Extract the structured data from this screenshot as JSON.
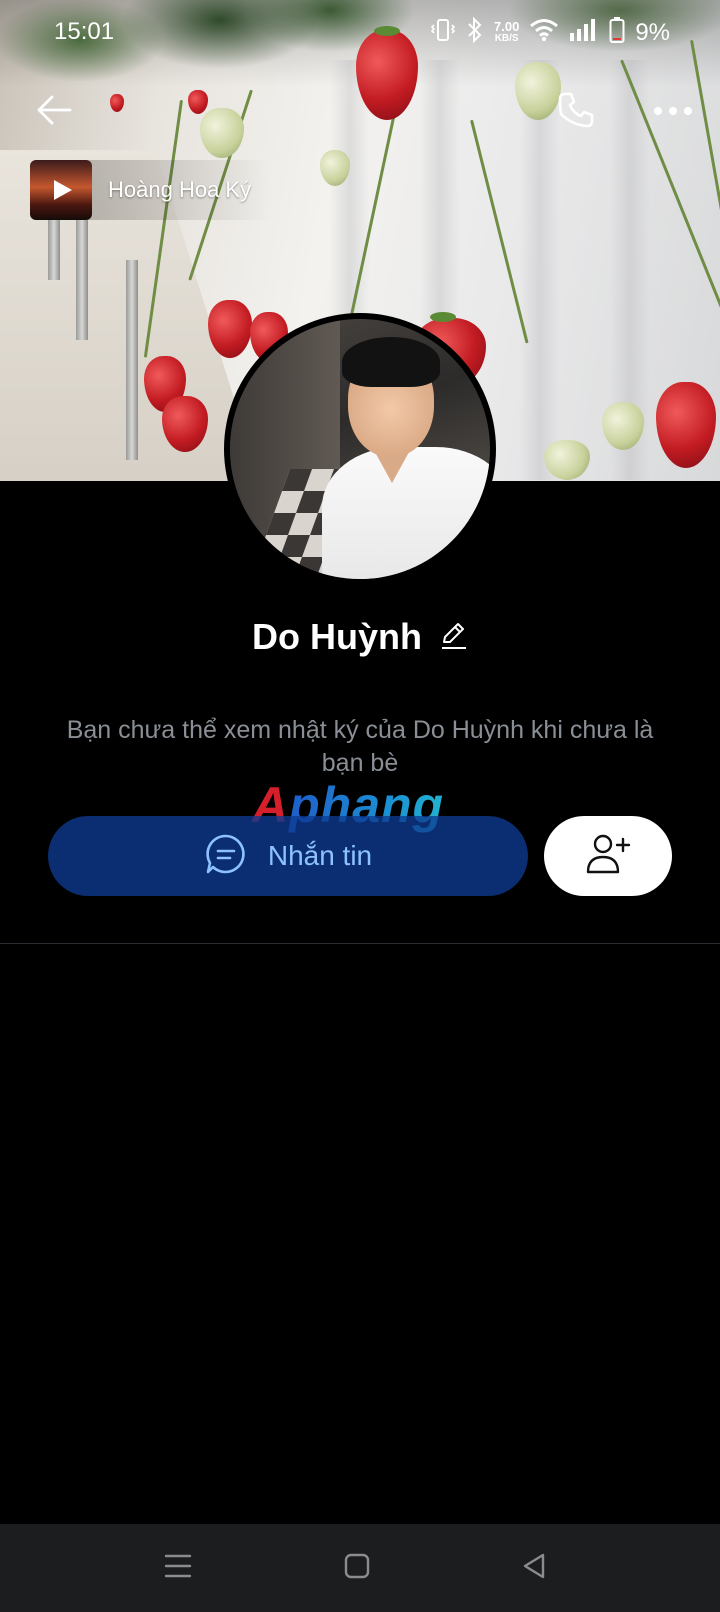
{
  "status_bar": {
    "time": "15:01",
    "network_speed_value": "7.00",
    "network_speed_unit": "KB/S",
    "battery": "9%",
    "icons": [
      "vibrate-icon",
      "bluetooth-icon",
      "wifi-icon",
      "signal-icon",
      "battery-icon"
    ]
  },
  "header": {
    "back_icon": "arrow-left-icon",
    "call_icon": "phone-icon",
    "more_icon": "more-horizontal-icon"
  },
  "music": {
    "title": "Hoàng Hoa Ký",
    "icon": "play-icon"
  },
  "profile": {
    "name": "Do Huỳnh",
    "edit_icon": "pencil-icon",
    "notice": "Bạn chưa thể xem nhật ký của Do Huỳnh khi chưa là bạn bè"
  },
  "watermark": "Aphang",
  "actions": {
    "message_label": "Nhắn tin",
    "message_icon": "chat-bubble-icon",
    "add_friend_icon": "add-user-icon"
  },
  "nav_bar": {
    "icons": [
      "menu-icon",
      "home-square-icon",
      "back-triangle-icon"
    ]
  },
  "colors": {
    "background": "#000000",
    "message_button": "#0d3b91",
    "message_text": "#8ec2ff",
    "notice_text": "#8a8f96",
    "nav_bar": "#1c1d1f"
  }
}
